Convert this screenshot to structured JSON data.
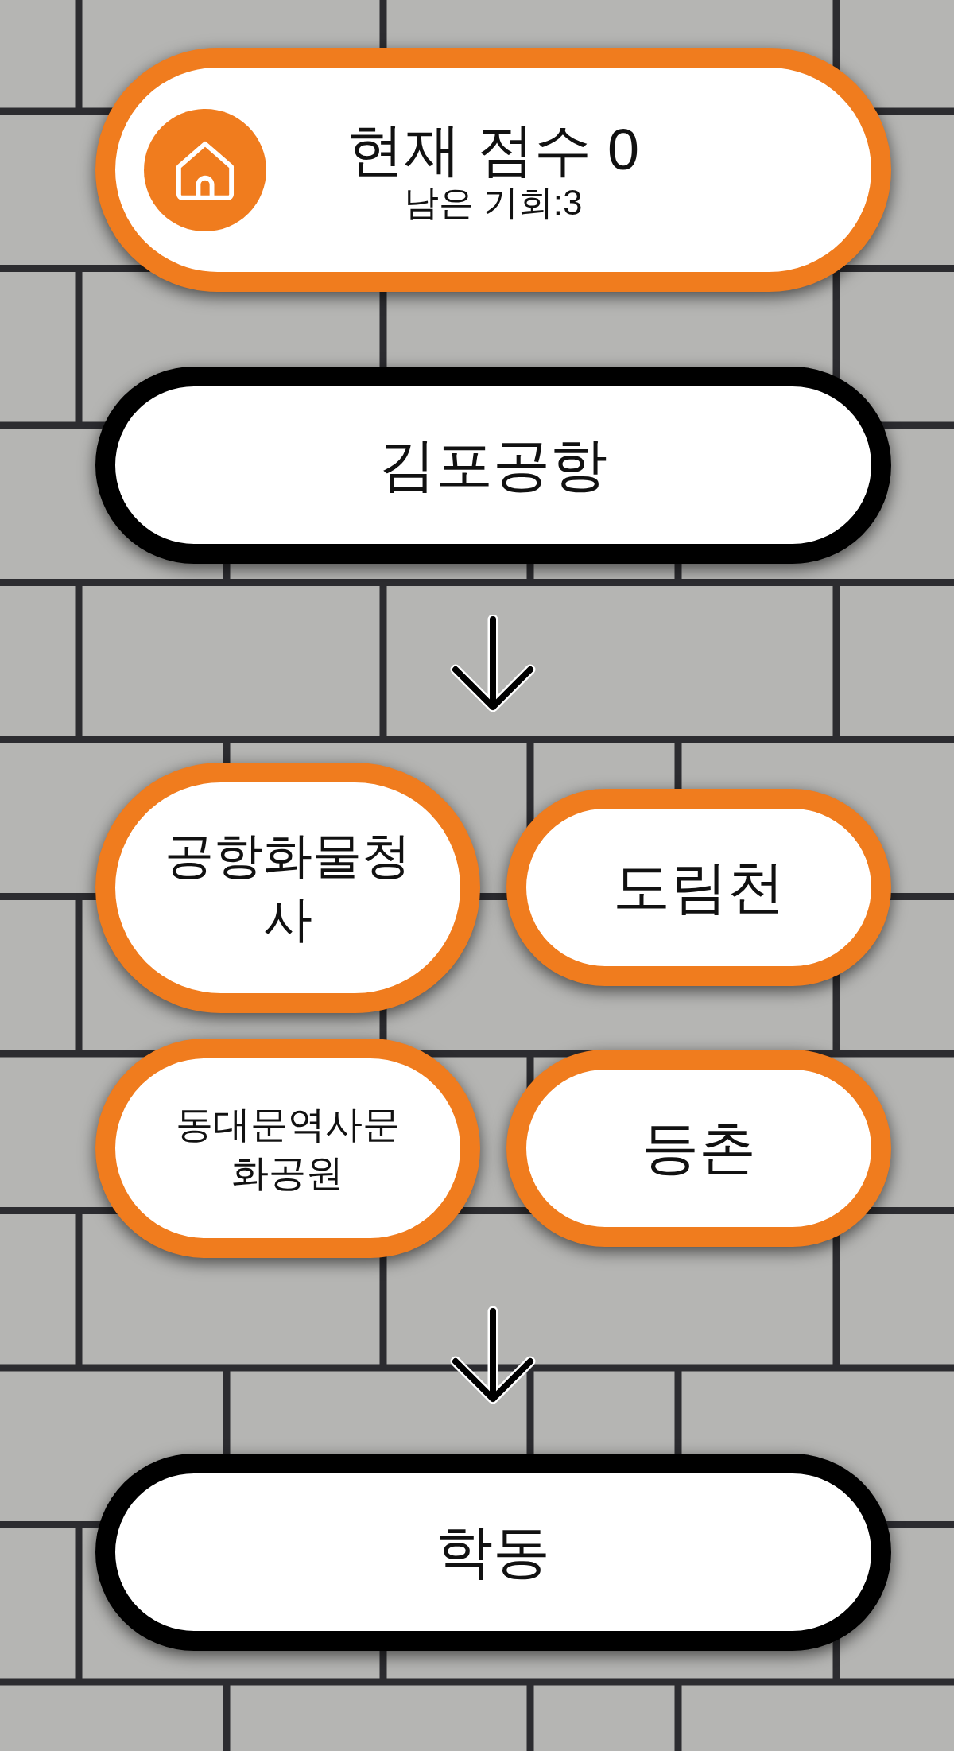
{
  "score_card": {
    "title": "현재 점수 0",
    "subtitle": "남은 기회:3"
  },
  "start_station": {
    "name": "김포공항"
  },
  "choices": [
    {
      "name": "공항화물청사"
    },
    {
      "name": "도림천"
    },
    {
      "name": "동대문역사문화공원"
    },
    {
      "name": "등촌"
    }
  ],
  "end_station": {
    "name": "학동"
  }
}
